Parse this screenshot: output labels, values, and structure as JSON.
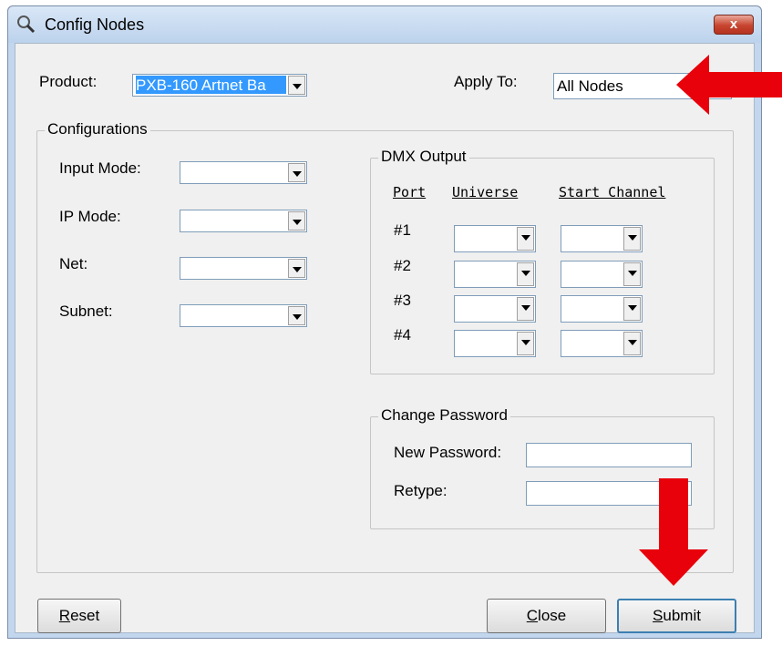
{
  "window": {
    "title": "Config Nodes",
    "close_label": "x"
  },
  "product": {
    "label": "Product:",
    "value": "PXB-160 Artnet Ba"
  },
  "apply_to": {
    "label": "Apply To:",
    "value": "All Nodes"
  },
  "configurations": {
    "title": "Configurations",
    "input_mode": {
      "label": "Input Mode:",
      "value": ""
    },
    "ip_mode": {
      "label": "IP Mode:",
      "value": ""
    },
    "net": {
      "label": "Net:",
      "value": ""
    },
    "subnet": {
      "label": "Subnet:",
      "value": ""
    }
  },
  "dmx_output": {
    "title": "DMX Output",
    "headers": {
      "port": "Port",
      "universe": "Universe",
      "start_channel": "Start Channel"
    },
    "ports": [
      {
        "label": "#1"
      },
      {
        "label": "#2"
      },
      {
        "label": "#3"
      },
      {
        "label": "#4"
      }
    ]
  },
  "change_password": {
    "title": "Change Password",
    "new_password": {
      "label": "New Password:",
      "value": ""
    },
    "retype": {
      "label": "Retype:",
      "value": ""
    }
  },
  "buttons": {
    "reset": {
      "mnemonic": "R",
      "rest": "eset"
    },
    "close": {
      "mnemonic": "C",
      "rest": "lose"
    },
    "submit": {
      "mnemonic": "S",
      "rest": "ubmit"
    }
  },
  "colors": {
    "annotation_arrow": "#e8000b",
    "selection": "#3399ff"
  }
}
